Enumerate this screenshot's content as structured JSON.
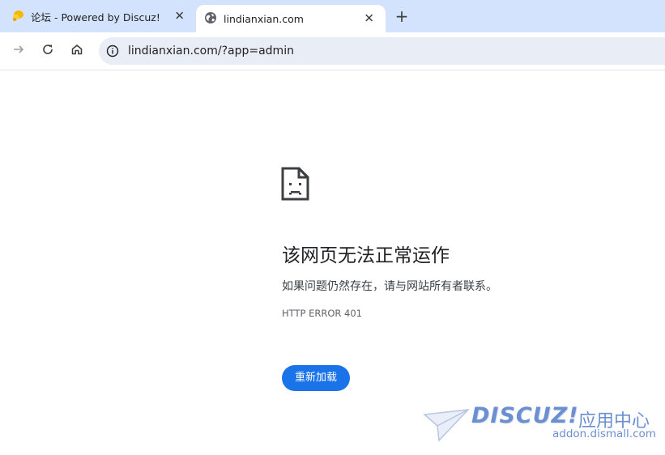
{
  "tabs": [
    {
      "title": "论坛 - Powered by Discuz!",
      "icon": "discuz-favicon-icon",
      "active": false
    },
    {
      "title": "lindianxian.com",
      "icon": "globe-icon",
      "active": true
    }
  ],
  "toolbar": {
    "url": "lindianxian.com/?app=admin"
  },
  "error": {
    "title": "该网页无法正常运作",
    "description": "如果问题仍然存在，请与网站所有者联系。",
    "code": "HTTP ERROR 401",
    "reload_label": "重新加载"
  },
  "watermark": {
    "brand": "DISCUZ!",
    "subtitle": "应用中心",
    "domain": "addon.dismall.com"
  },
  "colors": {
    "tabstrip": "#d3e3fd",
    "omnibox": "#e9eef6",
    "accent": "#1a73e8",
    "watermark": "#6b8fd0"
  }
}
